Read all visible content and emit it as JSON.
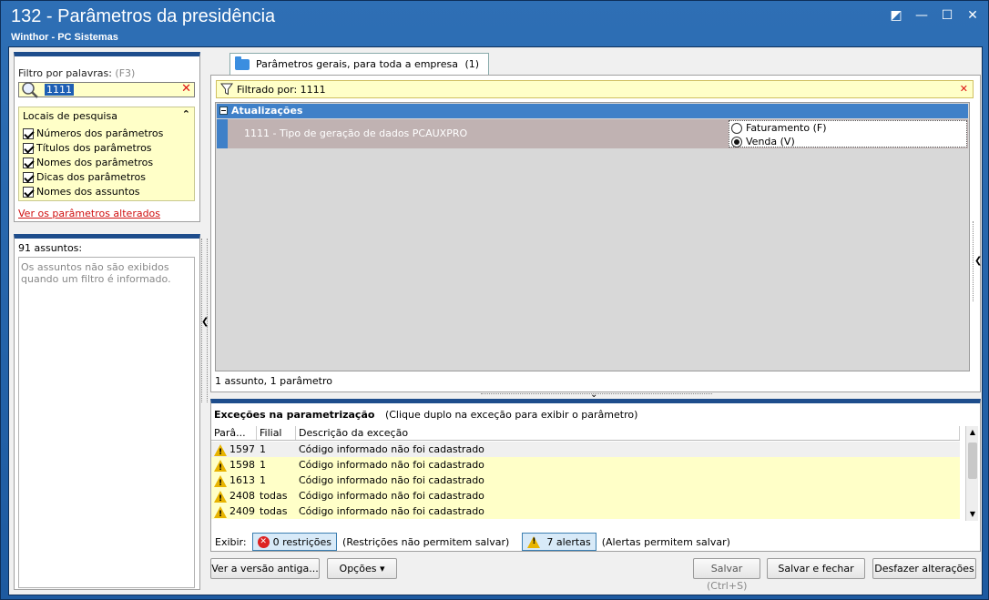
{
  "window": {
    "title": "132 - Parâmetros da presidência",
    "subtitle": "Winthor - PC Sistemas",
    "controls": {
      "restore": "◩",
      "minimize": "—",
      "maximize": "☐",
      "close": "✕"
    }
  },
  "filter": {
    "label": "Filtro por palavras:",
    "hint": "(F3)",
    "value": "1111",
    "clear": "✕"
  },
  "locais": {
    "title": "Locais de pesquisa",
    "collapse": "⌃",
    "items": [
      "Números dos parâmetros",
      "Títulos dos parâmetros",
      "Nomes dos parâmetros",
      "Dicas dos parâmetros",
      "Nomes dos assuntos"
    ]
  },
  "links": {
    "ver_alterados": "Ver os parâmetros alterados"
  },
  "assuntos": {
    "count": "91 assuntos:",
    "message": "Os assuntos não são exibidos quando um filtro é informado."
  },
  "tab": {
    "label": "Parâmetros gerais, para toda a empresa",
    "count": "(1)"
  },
  "filter_bar": {
    "text": "Filtrado por: 1111",
    "close": "✕"
  },
  "group": {
    "name": "Atualizações"
  },
  "param": {
    "label": "1111 - Tipo de geração de dados PCAUXPRO",
    "options": [
      "Faturamento (F)",
      "Venda (V)"
    ],
    "selected": "Venda (V)"
  },
  "status": "1 assunto, 1 parâmetro",
  "exceptions": {
    "title": "Exceções na parametrização",
    "instruction": "(Clique duplo na exceção para exibir o parâmetro)",
    "columns": [
      "Parâ...",
      "Filial",
      "Descrição da exceção"
    ],
    "rows": [
      {
        "param": "1597",
        "filial": "1",
        "desc": "Código informado não foi cadastrado"
      },
      {
        "param": "1598",
        "filial": "1",
        "desc": "Código informado não foi cadastrado"
      },
      {
        "param": "1613",
        "filial": "1",
        "desc": "Código informado não foi cadastrado"
      },
      {
        "param": "2408",
        "filial": "todas",
        "desc": "Código informado não foi cadastrado"
      },
      {
        "param": "2409",
        "filial": "todas",
        "desc": "Código informado não foi cadastrado"
      }
    ],
    "exibir_label": "Exibir:",
    "restricoes_btn": "0 restrições",
    "restricoes_note": "(Restrições não permitem salvar)",
    "alertas_btn": "7 alertas",
    "alertas_note": "(Alertas permitem salvar)"
  },
  "buttons": {
    "versao_antiga": "Ver a versão antiga...",
    "opcoes": "Opções ▾",
    "salvar": "Salvar",
    "salvar_shortcut": "(Ctrl+S)",
    "salvar_fechar": "Salvar e fechar",
    "desfazer": "Desfazer alterações"
  },
  "colors": {
    "accent": "#1e4d8c",
    "title_bg": "#2e6fb5",
    "highlight": "#ffffc8"
  }
}
